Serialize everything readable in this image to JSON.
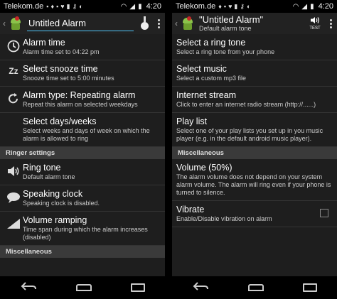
{
  "left": {
    "status": {
      "carrier": "Telekom.de",
      "time": "4:20",
      "notif_icons": [
        "▪",
        "♦",
        "▪",
        "♥",
        "▮",
        "⚷",
        "◐",
        "▪"
      ]
    },
    "actionbar": {
      "title": "Untitled Alarm"
    },
    "rows": [
      {
        "icon": "clock-icon",
        "glyph": "◴",
        "title": "Alarm time",
        "sub": "Alarm time set to 04:22 pm"
      },
      {
        "icon": "snooze-icon",
        "glyph": "ᶻᶻ",
        "title": "Select snooze time",
        "sub": "Snooze time set to 5:00 minutes"
      },
      {
        "icon": "repeat-icon",
        "glyph": "↻",
        "title": "Alarm type: Repeating alarm",
        "sub": "Repeat this alarm on selected weekdays"
      },
      {
        "icon": "",
        "glyph": "",
        "title": "Select days/weeks",
        "sub": "Select weeks and days of week on which the alarm is allowed to ring"
      }
    ],
    "section1": "Ringer settings",
    "rows2": [
      {
        "icon": "speaker-icon",
        "glyph": "🔈",
        "title": "Ring tone",
        "sub": "Default alarm tone"
      },
      {
        "icon": "speech-bubble-icon",
        "glyph": "●",
        "title": "Speaking clock",
        "sub": "Speaking clock is disabled."
      },
      {
        "icon": "volume-ramp-icon",
        "glyph": "◢",
        "title": "Volume ramping",
        "sub": "Time span during which the alarm increases (disabled)"
      }
    ],
    "section2": "Miscellaneous"
  },
  "right": {
    "status": {
      "carrier": "Telekom.de",
      "time": "4:20",
      "notif_icons": [
        "♦",
        "▪",
        "♥",
        "▮",
        "⚷",
        "◐",
        "▪"
      ]
    },
    "actionbar": {
      "title": "\"Untitled Alarm\"",
      "subtitle": "Default alarm tone",
      "test_label": "TEST"
    },
    "rows": [
      {
        "title": "Select a ring tone",
        "sub": "Select a ring tone from your phone"
      },
      {
        "title": "Select music",
        "sub": "Select a custom mp3 file"
      },
      {
        "title": "Internet stream",
        "sub": "Click to enter an internet radio stream (http://......)"
      },
      {
        "title": "Play list",
        "sub": "Select one of your play lists you set up in you music player (e.g. in the default android music player)."
      }
    ],
    "section1": "Miscellaneous",
    "rows2": [
      {
        "title": "Volume (50%)",
        "sub": "The alarm volume does not depend on your system alarm volume. The alarm will ring even if your phone is turned to silence."
      },
      {
        "title": "Vibrate",
        "sub": "Enable/Disable vibration on alarm",
        "checked": false
      }
    ]
  },
  "colors": {
    "accent": "#4fc3f7",
    "background": "#1e1e1e",
    "section": "#3a3a3a",
    "actionbar": "#222222"
  }
}
